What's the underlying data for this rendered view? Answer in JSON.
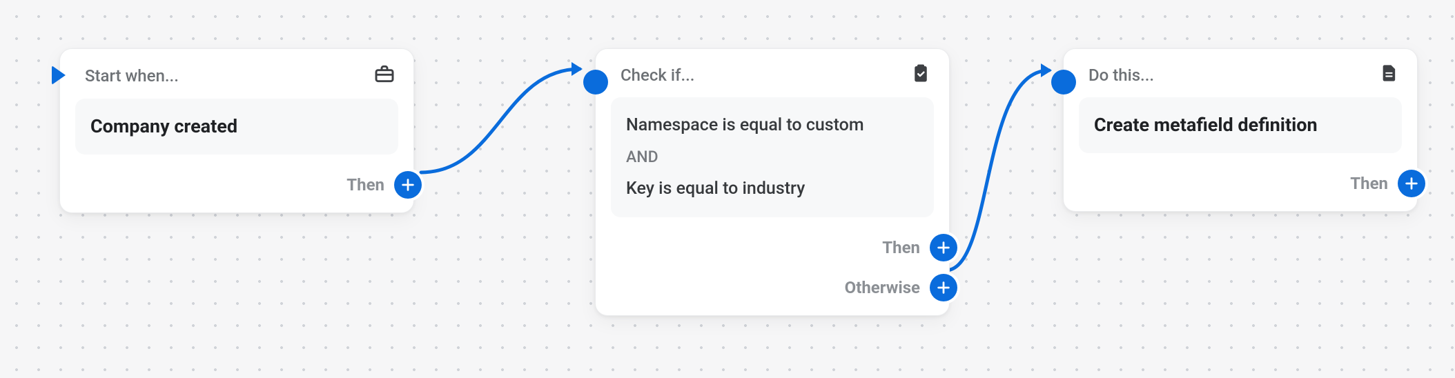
{
  "labels": {
    "then": "Then",
    "otherwise": "Otherwise",
    "and": "AND"
  },
  "trigger": {
    "heading": "Start when...",
    "title": "Company created"
  },
  "condition": {
    "heading": "Check if...",
    "line1": "Namespace is equal to custom",
    "line2": "Key is equal to industry"
  },
  "action": {
    "heading": "Do this...",
    "title": "Create metafield definition"
  }
}
